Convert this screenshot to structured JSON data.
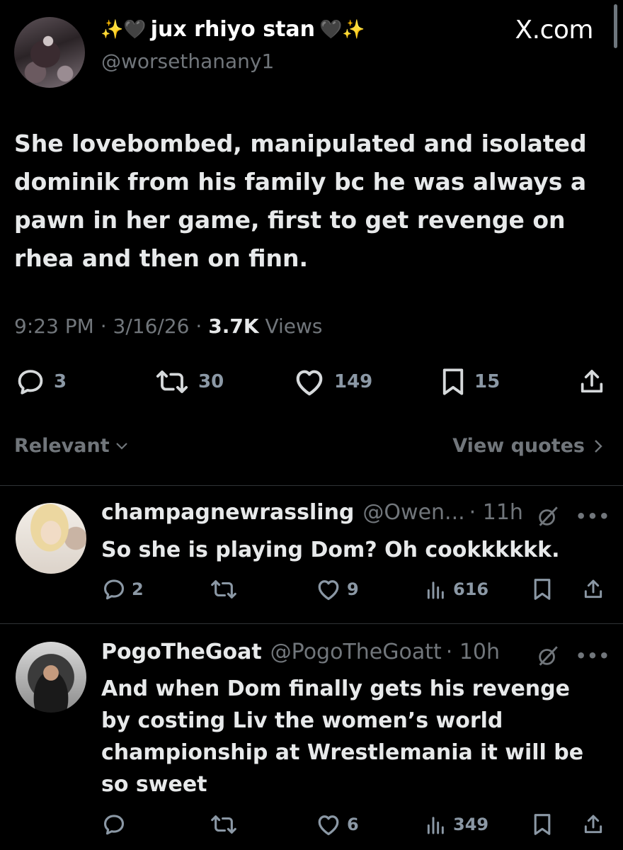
{
  "site": "X.com",
  "main_tweet": {
    "display_name": "jux rhiyo stan",
    "name_decor_left": "✨🖤",
    "name_decor_right": "🖤✨",
    "handle": "@worsethanany1",
    "text": "She lovebombed, manipulated and isolated dominik from his family bc he was always a pawn in her game, first to get revenge on rhea and then on finn.",
    "time": "9:23 PM",
    "date": "3/16/26",
    "views_count": "3.7K",
    "views_label": "Views",
    "separator": "·",
    "replies": "3",
    "reposts": "30",
    "likes": "149",
    "bookmarks": "15",
    "icons": [
      "reply-icon",
      "repost-icon",
      "like-icon",
      "bookmark-icon",
      "share-icon"
    ]
  },
  "sort": {
    "label": "Relevant",
    "icon": "chevron-down-icon"
  },
  "view_quotes": {
    "label": "View quotes",
    "icon": "chevron-right-icon"
  },
  "replies": [
    {
      "display_name": "champagnewrassling",
      "handle": "@Owen...",
      "age": "· 11h",
      "text": "So she is playing Dom? Oh cookkkkkk.",
      "replies": "2",
      "reposts": "",
      "likes": "9",
      "views": "616"
    },
    {
      "display_name": "PogoTheGoat",
      "handle": "@PogoTheGoatt",
      "age": "· 10h",
      "text": "And when Dom finally gets his revenge by costing Liv the women’s world championship at Wrestlemania it will be so sweet",
      "replies": "",
      "reposts": "",
      "likes": "6",
      "views": "349"
    }
  ],
  "colors": {
    "background": "#000000",
    "text": "#e7e9ea",
    "muted": "#71767b",
    "divider": "#2f3336"
  }
}
